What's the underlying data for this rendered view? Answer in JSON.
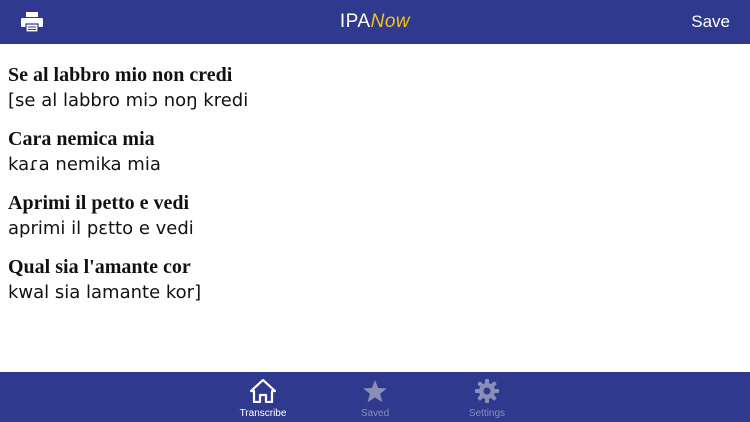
{
  "header": {
    "logo_part_a": "IPA",
    "logo_part_b": "Now",
    "save_label": "Save",
    "print_icon": "printer-icon"
  },
  "verses": [
    {
      "original": "Se al labbro mio non credi",
      "ipa": "[se al labbro miɔ noŋ kredi"
    },
    {
      "original": "Cara nemica mia",
      "ipa": "kaɾa nemika mia"
    },
    {
      "original": "Aprimi il petto e vedi",
      "ipa": "aprimi il pɛtto e vedi"
    },
    {
      "original": "Qual sia l'amante cor",
      "ipa": "kwal sia lamante kor]"
    }
  ],
  "tabs": [
    {
      "label": "Transcribe",
      "icon": "home-icon",
      "active": true
    },
    {
      "label": "Saved",
      "icon": "star-icon",
      "active": false
    },
    {
      "label": "Settings",
      "icon": "gear-icon",
      "active": false
    }
  ],
  "colors": {
    "bar": "#2f3a8f",
    "logo_accent": "#f2c316",
    "active_tab": "#ffffff",
    "inactive_tab": "#8a8fb8"
  }
}
